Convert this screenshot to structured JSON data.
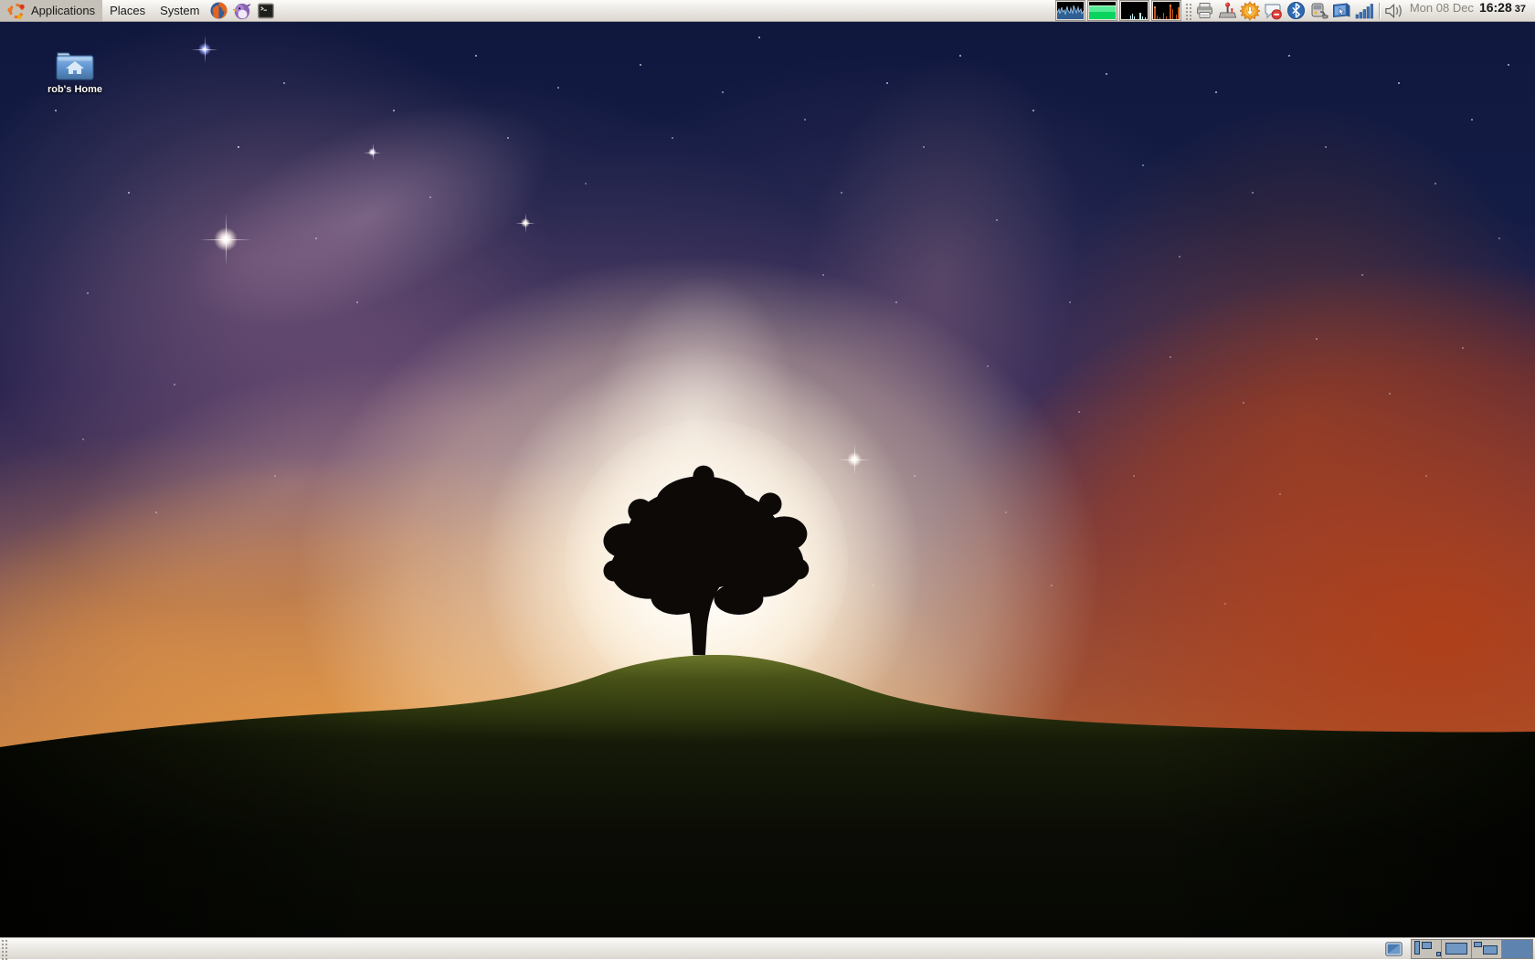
{
  "top_panel": {
    "menus": [
      {
        "label": "Applications"
      },
      {
        "label": "Places"
      },
      {
        "label": "System"
      }
    ],
    "launchers": [
      {
        "name": "Firefox Web Browser"
      },
      {
        "name": "Pidgin Internet Messenger"
      },
      {
        "name": "Terminal"
      }
    ],
    "system_monitors": [
      {
        "name": "CPU",
        "color": "#3f6fa0"
      },
      {
        "name": "Memory",
        "color": "#0bd45e"
      },
      {
        "name": "Network",
        "color": "#bfeef5"
      },
      {
        "name": "Disk",
        "color": "#c2571a"
      }
    ],
    "tray_icons": [
      {
        "name": "Printer"
      },
      {
        "name": "Hardware Drivers"
      },
      {
        "name": "Software Updates"
      },
      {
        "name": "Messaging Offline"
      },
      {
        "name": "Bluetooth"
      },
      {
        "name": "Power Manager"
      },
      {
        "name": "Remote Desktop"
      },
      {
        "name": "Network Signal"
      },
      {
        "name": "Volume"
      }
    ],
    "clock": {
      "date": "Mon 08 Dec",
      "time": "16:28",
      "seconds": "37"
    }
  },
  "desktop": {
    "icons": [
      {
        "label": "rob's Home"
      }
    ]
  },
  "bottom_panel": {
    "workspace_count": 4,
    "active_workspace": 4
  },
  "colors": {
    "panel_bg": "#eceae5",
    "workspace_active": "#5f83af",
    "workspace_window": "#7098c2",
    "sky_navy": "#131c45",
    "glow_white": "#fff6e8",
    "nebula_orange": "#e89c4c",
    "nebula_red": "#b23e16",
    "grass_green": "#3c470f"
  }
}
